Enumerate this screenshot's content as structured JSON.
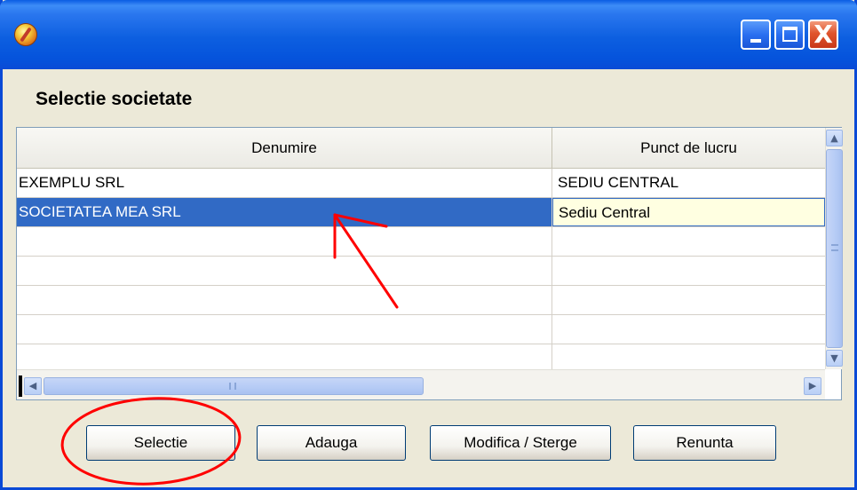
{
  "window": {
    "icon": "app-icon",
    "controls": [
      "minimize-icon",
      "maximize-icon",
      "close-icon"
    ],
    "close_glyph": "X"
  },
  "dialog": {
    "heading": "Selectie societate"
  },
  "grid": {
    "columns": [
      "Denumire",
      "Punct de lucru"
    ],
    "rows": [
      {
        "denumire": "EXEMPLU SRL",
        "punct": "SEDIU CENTRAL"
      },
      {
        "denumire": "SOCIETATEA MEA SRL",
        "punct": "Sediu Central"
      },
      {
        "denumire": "",
        "punct": ""
      },
      {
        "denumire": "",
        "punct": ""
      },
      {
        "denumire": "",
        "punct": ""
      },
      {
        "denumire": "",
        "punct": ""
      },
      {
        "denumire": "",
        "punct": ""
      }
    ],
    "selected_row": 1
  },
  "buttons": {
    "selectie": "Selectie",
    "adauga": "Adauga",
    "modifica": "Modifica / Sterge",
    "renunta": "Renunta"
  },
  "colors": {
    "selection": "#316ac5",
    "annotation": "#ff0000",
    "titlebar": "#0a5ce3"
  }
}
